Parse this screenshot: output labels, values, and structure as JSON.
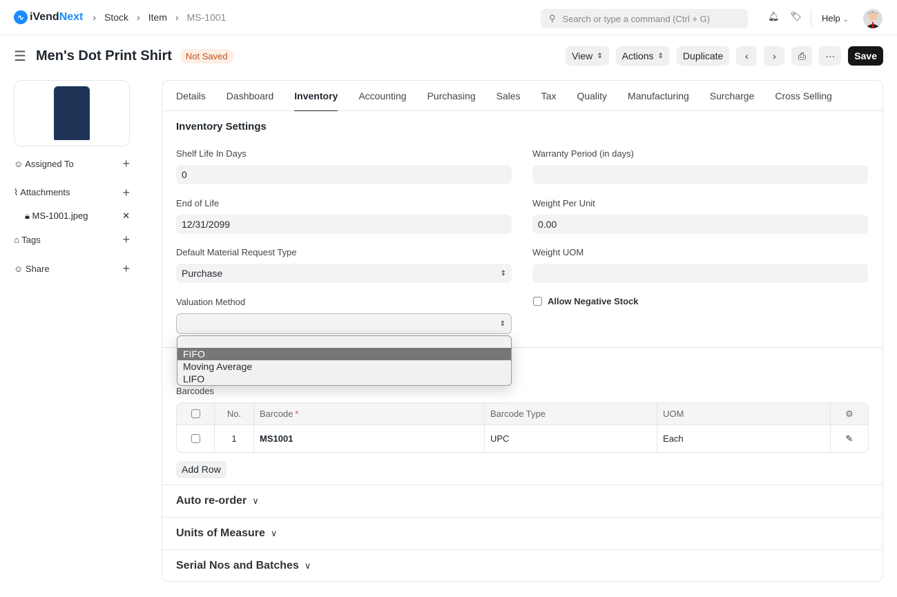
{
  "navbar": {
    "logo_prefix": "iVend",
    "logo_suffix": "Next",
    "breadcrumbs": [
      "Stock",
      "Item",
      "MS-1001"
    ],
    "search_placeholder": "Search or type a command (Ctrl + G)",
    "help_label": "Help"
  },
  "header": {
    "title": "Men's Dot Print Shirt",
    "status": "Not Saved",
    "view_label": "View",
    "actions_label": "Actions",
    "duplicate_label": "Duplicate",
    "save_label": "Save"
  },
  "sidebar": {
    "assigned_to": "Assigned To",
    "attachments": "Attachments",
    "attachment_file": "MS-1001.jpeg",
    "tags": "Tags",
    "share": "Share"
  },
  "tabs": [
    "Details",
    "Dashboard",
    "Inventory",
    "Accounting",
    "Purchasing",
    "Sales",
    "Tax",
    "Quality",
    "Manufacturing",
    "Surcharge",
    "Cross Selling"
  ],
  "active_tab": "Inventory",
  "inventory": {
    "section_title": "Inventory Settings",
    "shelf_life_label": "Shelf Life In Days",
    "shelf_life_value": "0",
    "warranty_label": "Warranty Period (in days)",
    "warranty_value": "",
    "end_of_life_label": "End of Life",
    "end_of_life_value": "12/31/2099",
    "weight_label": "Weight Per Unit",
    "weight_value": "0.00",
    "mr_type_label": "Default Material Request Type",
    "mr_type_value": "Purchase",
    "weight_uom_label": "Weight UOM",
    "weight_uom_value": "",
    "valuation_label": "Valuation Method",
    "valuation_value": "",
    "valuation_options": [
      "FIFO",
      "Moving Average",
      "LIFO"
    ],
    "valuation_highlighted": "FIFO",
    "allow_negative_label": "Allow Negative Stock",
    "allow_negative_checked": false
  },
  "barcodes": {
    "label": "Barcodes",
    "columns": [
      "No.",
      "Barcode",
      "Barcode Type",
      "UOM"
    ],
    "rows": [
      {
        "no": "1",
        "barcode": "MS1001",
        "type": "UPC",
        "uom": "Each"
      }
    ],
    "add_row": "Add Row"
  },
  "sections": [
    "Auto re-order",
    "Units of Measure",
    "Serial Nos and Batches"
  ]
}
